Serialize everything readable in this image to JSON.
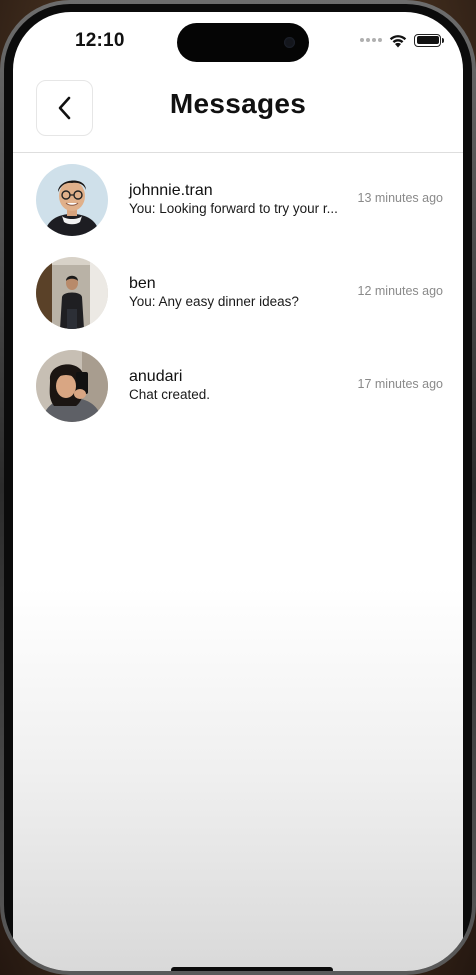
{
  "status_bar": {
    "time": "12:10",
    "icons": [
      "cellular-dots-icon",
      "wifi-icon",
      "battery-icon"
    ]
  },
  "header": {
    "title": "Messages",
    "back_icon": "chevron-left-icon"
  },
  "conversations": [
    {
      "name": "johnnie.tran",
      "preview": "You: Looking forward to try your r...",
      "time": "13 minutes ago"
    },
    {
      "name": "ben",
      "preview": "You: Any easy dinner ideas?",
      "time": "12 minutes ago"
    },
    {
      "name": "anudari",
      "preview": "Chat created.",
      "time": "17 minutes ago"
    }
  ],
  "colors": {
    "text_primary": "#111111",
    "text_secondary": "#8a8a8a",
    "divider": "#dedede"
  }
}
